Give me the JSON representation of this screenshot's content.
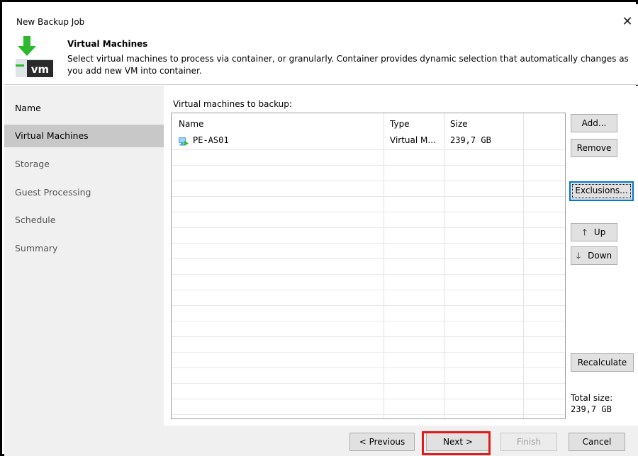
{
  "window": {
    "title": "New Backup Job",
    "close_icon": "close-icon"
  },
  "header": {
    "title": "Virtual Machines",
    "description": "Select virtual machines to process via container, or granularly. Container provides dynamic selection that automatically changes as you add new VM into container.",
    "logo_icon": "vm-download-icon",
    "logo_text": "vm",
    "accent_color": "#2eb82e"
  },
  "nav": {
    "items": [
      {
        "label": "Name",
        "state": "done"
      },
      {
        "label": "Virtual Machines",
        "state": "active"
      },
      {
        "label": "Storage",
        "state": "pending"
      },
      {
        "label": "Guest Processing",
        "state": "pending"
      },
      {
        "label": "Schedule",
        "state": "pending"
      },
      {
        "label": "Summary",
        "state": "pending"
      }
    ]
  },
  "grid": {
    "label": "Virtual machines to backup:",
    "columns": [
      "Name",
      "Type",
      "Size"
    ],
    "rows": [
      {
        "name": "PE-AS01",
        "type": "Virtual M...",
        "size": "239,7 GB",
        "icon": "vm-icon"
      }
    ]
  },
  "side_buttons": {
    "add": "Add...",
    "remove": "Remove",
    "exclusions": "Exclusions...",
    "up": "Up",
    "down": "Down",
    "recalculate": "Recalculate"
  },
  "total": {
    "label": "Total size:",
    "value": "239,7 GB"
  },
  "footer": {
    "previous": "< Previous",
    "next": "Next >",
    "finish": "Finish",
    "cancel": "Cancel",
    "highlight_color": "#e01b1b"
  }
}
